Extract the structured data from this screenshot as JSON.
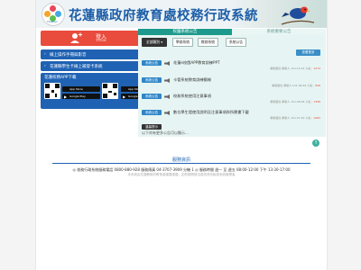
{
  "header": {
    "logo_caption": "Hualien",
    "title": "花蓮縣政府教育處校務行政系統"
  },
  "login": {
    "label": "登入",
    "sub": "LOGIN"
  },
  "links": [
    {
      "label": "線上操作手冊與影音"
    },
    {
      "label": "花蓮縣學生卡線上補發卡系統"
    }
  ],
  "app": {
    "title": "花蓮校務APP下載",
    "stores": [
      "App Store",
      "Google Play",
      "App Store",
      "Google Play"
    ]
  },
  "tabs": {
    "active": "校園系統公告",
    "inactive": "系統重要公告"
  },
  "filters": {
    "all": "全部類別",
    "f2": "學務系統",
    "f3": "教務系統",
    "f4": "系統公告"
  },
  "more_button": "查看更多",
  "announcements": [
    {
      "badge": "系統公告",
      "title": "花蓮e校園APP教育訓練PPT",
      "meta": "承辦單位  承辦人  111.10.12 人氣：",
      "views": "1274"
    },
    {
      "badge": "系統公告",
      "title": "卡管系統教育訓練簡報",
      "meta": "承辦單位  承辦人  111.09.29 人氣：",
      "views": "846"
    },
    {
      "badge": "系統公告",
      "title": "校務系統使用注意事項",
      "meta": "承辦單位  承辦人  111.08.05 人氣：",
      "views": "1398"
    },
    {
      "badge": "系統公告",
      "title": "數位學生證使用說明及注意事項與所需書下載",
      "meta": "承辦單位  承辦人  111.07.20 人氣：",
      "views": "1082"
    }
  ],
  "tip": {
    "badge": "溫馨提示",
    "text": "以下尚有更多公告可以顯示..."
  },
  "footer": {
    "title": "服務資訊",
    "info": "◎ 校務行政系統服務電話 0800-880-928   服務傳真 04-3707-3909 分機 1   ◎ 服務時間 週一 至 週五 08:00-12:00 下午 13:30-17:00",
    "note": "本系統由花蓮縣政府教育處建置維護，如有疑問請洽各校資訊組或系統管理者"
  },
  "colors": {
    "red": "#e94b3c",
    "blue": "#1f62b3",
    "teal": "#1d9a8c"
  }
}
